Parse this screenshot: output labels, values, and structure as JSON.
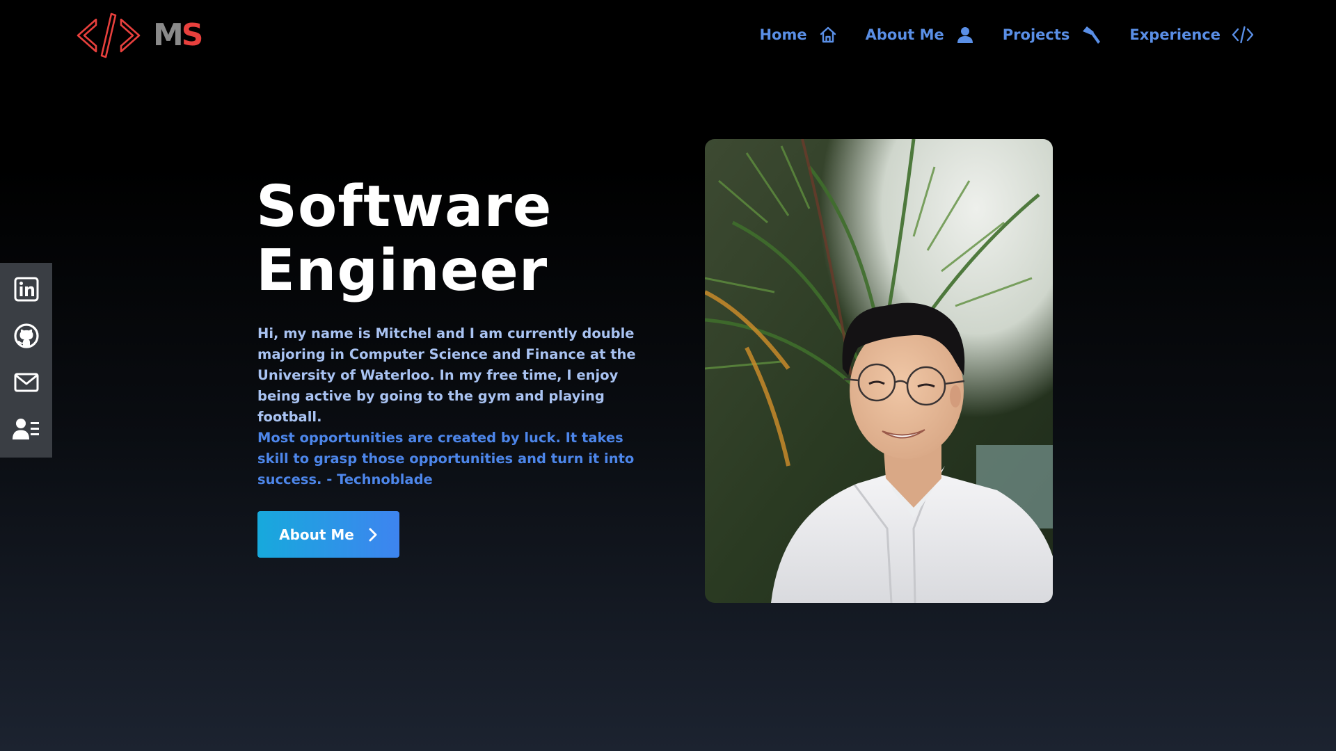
{
  "header": {
    "logo": {
      "code_icon": "code-brackets-icon",
      "initial_m": "M",
      "initial_s": "S"
    },
    "nav": [
      {
        "label": "Home",
        "icon": "home-icon"
      },
      {
        "label": "About Me",
        "icon": "user-icon"
      },
      {
        "label": "Projects",
        "icon": "hammer-icon"
      },
      {
        "label": "Experience",
        "icon": "code-icon"
      }
    ]
  },
  "social": [
    {
      "icon": "linkedin-icon"
    },
    {
      "icon": "github-icon"
    },
    {
      "icon": "mail-icon"
    },
    {
      "icon": "resume-icon"
    }
  ],
  "hero": {
    "title_line1": "Software",
    "title_line2": "Engineer",
    "intro": "Hi, my name is Mitchel and I am currently double majoring in Computer Science and Finance at the University of Waterloo. In my free time, I enjoy being active by going to the gym and playing football.",
    "quote": "Most opportunities are created by luck. It takes skill to grasp those opportunities and turn it into success. - Technoblade",
    "cta_label": "About Me",
    "cta_icon": "chevron-right-icon"
  },
  "portrait": {
    "subject": "portrait-photo"
  },
  "colors": {
    "nav_text": "#5a8fe6",
    "intro_text": "#a9c3f2",
    "quote_text": "#4d86ea",
    "logo_red": "#e8403d",
    "logo_gray": "#8a8a8a",
    "sidebar_bg": "#3a3e44",
    "button_gradient_start": "#17a9dc",
    "button_gradient_end": "#3e84f0"
  }
}
